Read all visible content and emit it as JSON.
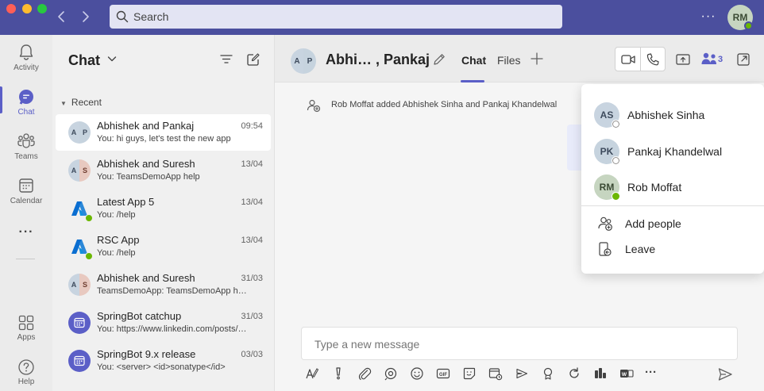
{
  "titlebar": {
    "search_placeholder": "Search",
    "more_label": "···",
    "user_initials": "RM"
  },
  "rail": {
    "items": [
      {
        "label": "Activity",
        "icon": "bell-icon"
      },
      {
        "label": "Chat",
        "icon": "chat-icon"
      },
      {
        "label": "Teams",
        "icon": "teams-icon"
      },
      {
        "label": "Calendar",
        "icon": "calendar-icon"
      },
      {
        "label": "···",
        "icon": "more-icon"
      },
      {
        "label": "Apps",
        "icon": "apps-icon"
      },
      {
        "label": "Help",
        "icon": "help-icon"
      }
    ]
  },
  "chatpane": {
    "title": "Chat",
    "recent_label": "Recent",
    "chats": [
      {
        "name": "Abhishek and Pankaj",
        "time": "09:54",
        "preview": "You: hi guys, let's test the new app",
        "initials": [
          "A",
          "P"
        ]
      },
      {
        "name": "Abhishek and Suresh",
        "time": "13/04",
        "preview": "You: TeamsDemoApp help",
        "initials": [
          "A",
          "S"
        ]
      },
      {
        "name": "Latest App 5",
        "time": "13/04",
        "preview": "You: /help"
      },
      {
        "name": "RSC App",
        "time": "13/04",
        "preview": "You: /help"
      },
      {
        "name": "Abhishek and Suresh",
        "time": "31/03",
        "preview": "TeamsDemoApp: TeamsDemoApp help",
        "initials": [
          "A",
          "S"
        ]
      },
      {
        "name": "SpringBot catchup",
        "time": "31/03",
        "preview": "You: https://www.linkedin.com/posts/abc"
      },
      {
        "name": "SpringBot 9.x release",
        "time": "03/03",
        "preview": "You: <server> <id>sonatype</id>"
      }
    ]
  },
  "header": {
    "initials": [
      "A",
      "P"
    ],
    "title": "Abhi… , Pankaj",
    "tabs": [
      "Chat",
      "Files"
    ],
    "participant_count": "3"
  },
  "conversation": {
    "system_message": "Rob Moffat added Abhishek Sinha and Pankaj Khandelwal"
  },
  "compose": {
    "placeholder": "Type a new message"
  },
  "participants_popup": {
    "people": [
      {
        "initials": "AS",
        "name": "Abhishek Sinha",
        "status": "offline"
      },
      {
        "initials": "PK",
        "name": "Pankaj Khandelwal",
        "status": "offline"
      },
      {
        "initials": "RM",
        "name": "Rob Moffat",
        "status": "available"
      }
    ],
    "actions": [
      {
        "label": "Add people",
        "icon": "add-person-icon"
      },
      {
        "label": "Leave",
        "icon": "leave-icon"
      }
    ]
  },
  "colors": {
    "titlebar": "#4b4f9e",
    "brand": "#5b5fc7",
    "available": "#6bb700"
  }
}
